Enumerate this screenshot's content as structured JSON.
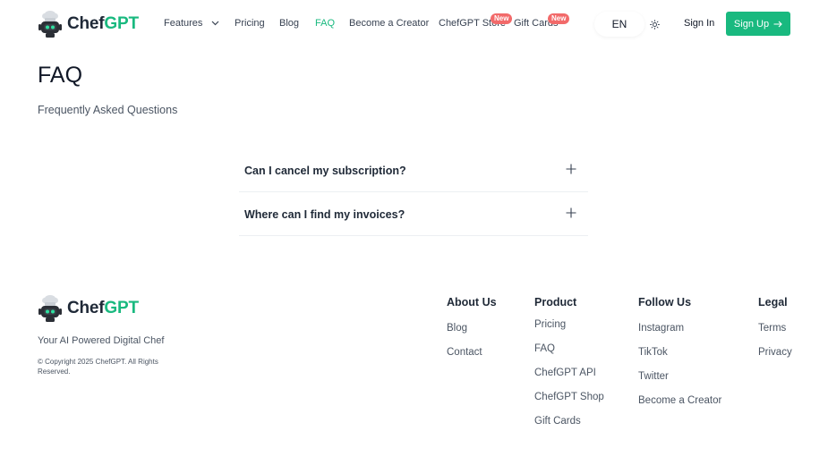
{
  "header": {
    "brand_prefix": "Chef",
    "brand_suffix": "GPT",
    "nav": {
      "features": "Features",
      "pricing": "Pricing",
      "blog": "Blog",
      "faq": "FAQ",
      "become_creator": "Become a Creator",
      "store": "ChefGPT Store",
      "gift_cards": "Gift Cards"
    },
    "badges": {
      "store": "New",
      "gift_cards": "New"
    },
    "language": "EN",
    "sign_in": "Sign In",
    "sign_up": "Sign Up"
  },
  "main": {
    "title": "FAQ",
    "subtitle": "Frequently Asked Questions",
    "faqs": [
      {
        "question": "Can I cancel my subscription?"
      },
      {
        "question": "Where can I find my invoices?"
      }
    ]
  },
  "footer": {
    "brand_prefix": "Chef",
    "brand_suffix": "GPT",
    "tagline": "Your AI Powered Digital Chef",
    "copyright": "© Copyright 2025 ChefGPT. All Rights Reserved.",
    "columns": {
      "about": {
        "title": "About Us",
        "links": [
          "Blog",
          "Contact"
        ]
      },
      "product": {
        "title": "Product",
        "links": [
          "Pricing",
          "FAQ",
          "ChefGPT API",
          "ChefGPT Shop",
          "Gift Cards"
        ]
      },
      "follow": {
        "title": "Follow Us",
        "links": [
          "Instagram",
          "TikTok",
          "Twitter",
          "Become a Creator"
        ]
      },
      "legal": {
        "title": "Legal",
        "links": [
          "Terms",
          "Privacy"
        ]
      }
    }
  },
  "colors": {
    "accent": "#19b97f",
    "badge": "#f26a6a",
    "text": "#1f2937"
  },
  "icons": {
    "logo": "chef-robot-icon",
    "features_dropdown": "chevron-down-icon",
    "theme": "sun-icon",
    "sign_up": "arrow-right-icon",
    "faq_expand": "plus-icon"
  }
}
